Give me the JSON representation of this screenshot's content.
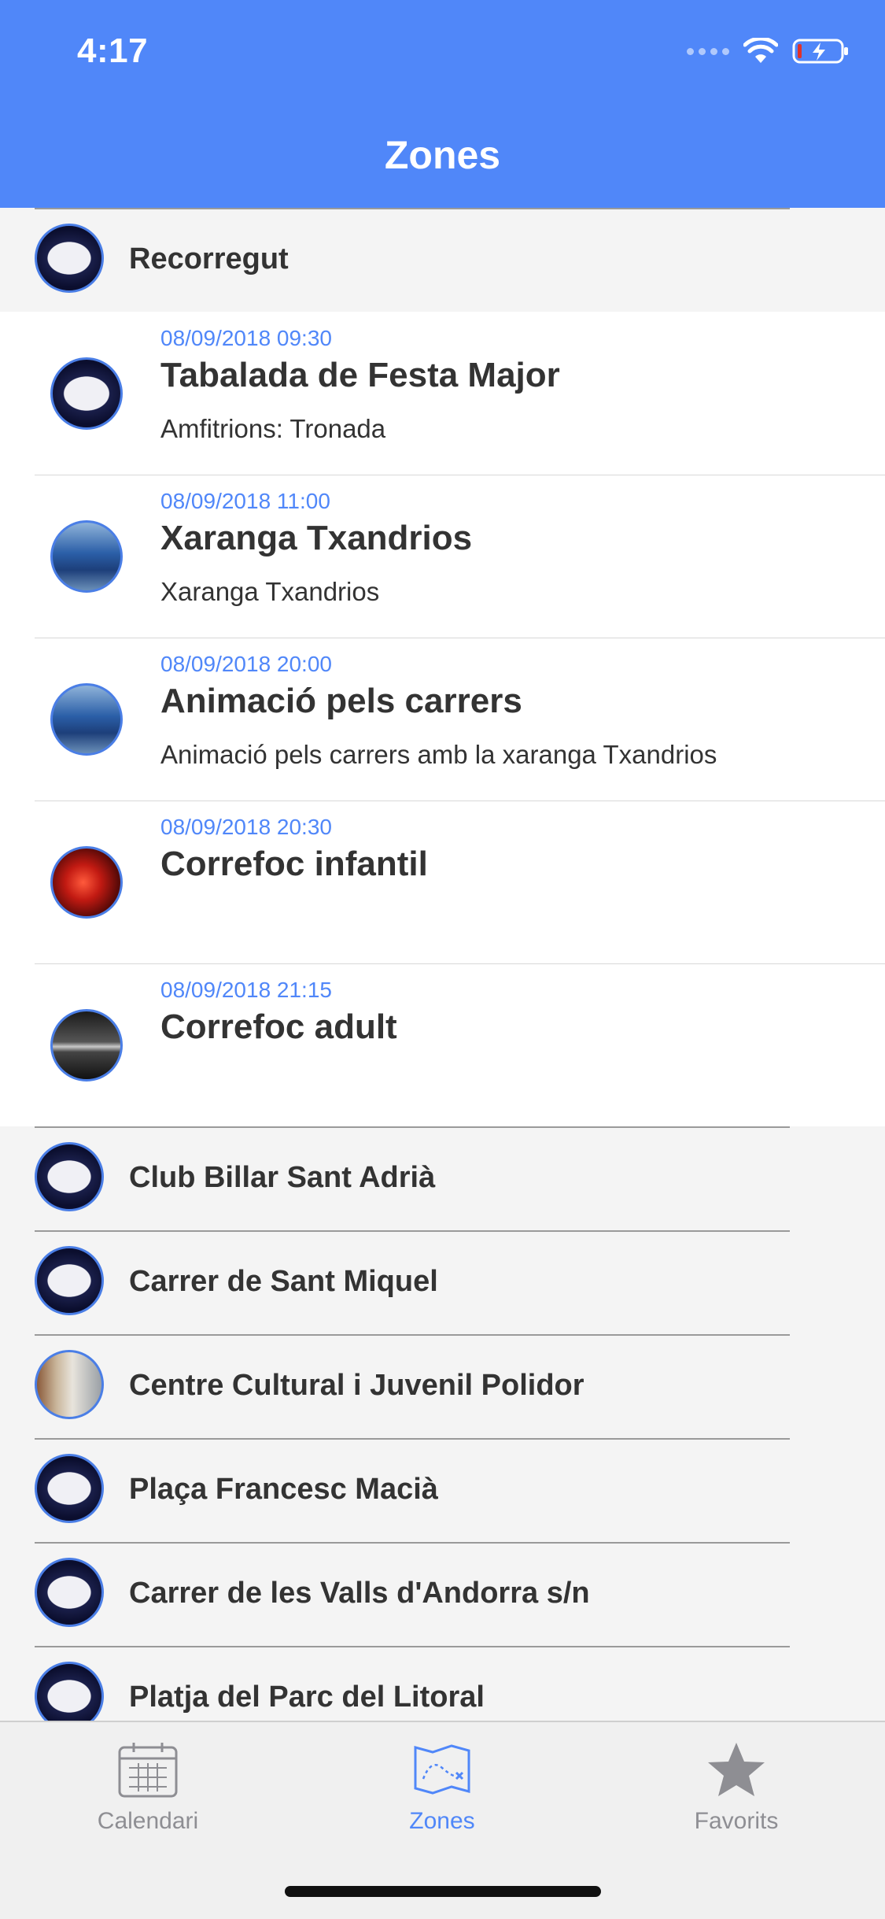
{
  "status": {
    "time": "4:17"
  },
  "header": {
    "title": "Zones"
  },
  "zones_top": [
    {
      "label": "Recorregut"
    }
  ],
  "events": [
    {
      "date": "08/09/2018 09:30",
      "title": "Tabalada de Festa Major",
      "description": "Amfitrions: Tronada",
      "image": "logo"
    },
    {
      "date": "08/09/2018 11:00",
      "title": "Xaranga Txandrios",
      "description": "Xaranga Txandrios",
      "image": "photo-blue"
    },
    {
      "date": "08/09/2018 20:00",
      "title": "Animació pels carrers",
      "description": "Animació pels carrers amb la xaranga Txandrios",
      "image": "photo-blue"
    },
    {
      "date": "08/09/2018 20:30",
      "title": "Correfoc infantil",
      "description": "",
      "image": "photo-red"
    },
    {
      "date": "08/09/2018 21:15",
      "title": "Correfoc adult",
      "description": "",
      "image": "photo-dark"
    }
  ],
  "zones": [
    {
      "label": "Club Billar Sant Adrià",
      "image": "logo"
    },
    {
      "label": "Carrer de Sant Miquel",
      "image": "logo"
    },
    {
      "label": "Centre Cultural i Juvenil Polidor",
      "image": "photo-building"
    },
    {
      "label": "Plaça Francesc Macià",
      "image": "logo"
    },
    {
      "label": "Carrer de les Valls d'Andorra s/n",
      "image": "logo"
    },
    {
      "label": "Platja del Parc del Litoral",
      "image": "logo"
    }
  ],
  "tabbar": {
    "tabs": [
      {
        "label": "Calendari",
        "icon": "calendar-icon",
        "active": false
      },
      {
        "label": "Zones",
        "icon": "map-icon",
        "active": true
      },
      {
        "label": "Favorits",
        "icon": "star-icon",
        "active": false
      }
    ]
  },
  "colors": {
    "accent": "#5087f9",
    "inactive": "#8e8e93",
    "text": "#333333"
  }
}
